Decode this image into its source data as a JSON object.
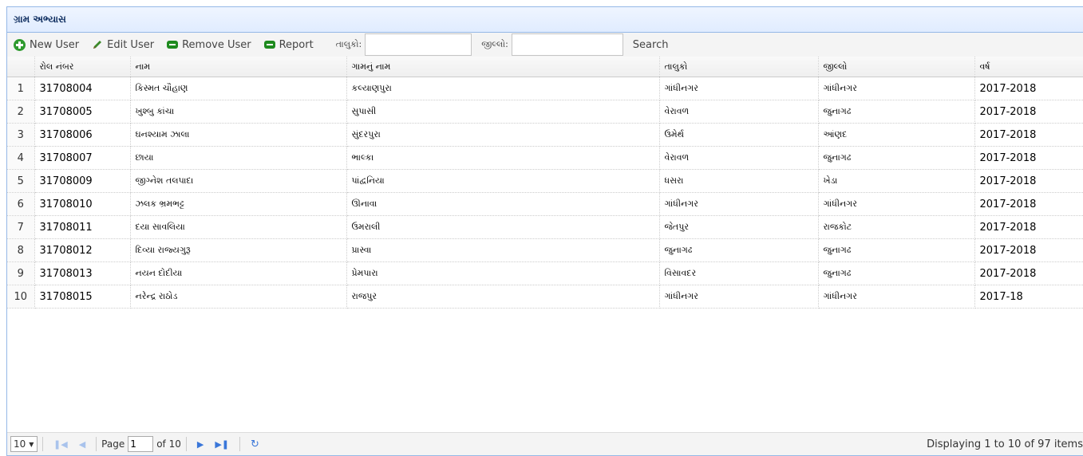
{
  "panel": {
    "title": "ગ્રામ અભ્યાસ"
  },
  "toolbar": {
    "new_user": "New User",
    "edit_user": "Edit User",
    "remove_user": "Remove User",
    "report": "Report",
    "taluka_label": "તાલુકો:",
    "district_label": "જીલ્લો:",
    "search": "Search"
  },
  "table": {
    "columns": [
      "રોલ નંબર",
      "નામ",
      "ગામનું નામ",
      "તાલુકો",
      "જીલ્લો",
      "વર્ષ"
    ],
    "rows": [
      {
        "n": "1",
        "roll": "31708004",
        "name": "કિસ્મત ચૌહાણ",
        "village": "કલ્યાણપુરા",
        "taluka": "ગાંધીનગર",
        "district": "ગાંધીનગર",
        "year": "2017-2018"
      },
      {
        "n": "2",
        "roll": "31708005",
        "name": "ખુશ્બુ કાંચા",
        "village": "સુપાસી",
        "taluka": "વેરાવળ",
        "district": "જુનાગઢ",
        "year": "2017-2018"
      },
      {
        "n": "3",
        "roll": "31708006",
        "name": "ઘનશ્યામ ઝાલા",
        "village": "સુંદરપુરા",
        "taluka": "ઉમેર્થ",
        "district": "આંણદ",
        "year": "2017-2018"
      },
      {
        "n": "4",
        "roll": "31708007",
        "name": "છાયા",
        "village": "ભાલ્કા",
        "taluka": "વેરાવળ",
        "district": "જુનાગઢ",
        "year": "2017-2018"
      },
      {
        "n": "5",
        "roll": "31708009",
        "name": "જીગ્નેશ તલપાદા",
        "village": "પાંદ્વનિયા",
        "taluka": "ધસરા",
        "district": "ખેડા",
        "year": "2017-2018"
      },
      {
        "n": "6",
        "roll": "31708010",
        "name": "ઝલક ભ્રમભટ્ટ",
        "village": "ઊનાવા",
        "taluka": "ગાંધીનગર",
        "district": "ગાંધીનગર",
        "year": "2017-2018"
      },
      {
        "n": "7",
        "roll": "31708011",
        "name": "દયા સાવલિયા",
        "village": "ઉમરાલી",
        "taluka": "જેતપુર",
        "district": "રાજકોટ",
        "year": "2017-2018"
      },
      {
        "n": "8",
        "roll": "31708012",
        "name": "દિવ્યા રાજ્યગુરૂ",
        "village": "પ્રાસ્વા",
        "taluka": "જુનાગઢ",
        "district": "જુનાગઢ",
        "year": "2017-2018"
      },
      {
        "n": "9",
        "roll": "31708013",
        "name": "નયન દોદીયા",
        "village": "પ્રેમપારા",
        "taluka": "વિસાવદર",
        "district": "જુનાગઢ",
        "year": "2017-2018"
      },
      {
        "n": "10",
        "roll": "31708015",
        "name": "નરેન્દ્ર રાઠોડ",
        "village": "રાજપુર",
        "taluka": "ગાંધીનગર",
        "district": "ગાંધીનગર",
        "year": "2017-18"
      }
    ]
  },
  "pager": {
    "page_size": "10",
    "page_label": "Page",
    "page_value": "1",
    "of_label": "of 10",
    "display": "Displaying 1 to 10 of 97 items"
  },
  "colors": {
    "header_border": "#95b8e7",
    "title_text": "#0e2d5f",
    "pager_icon": "#3a77d9"
  },
  "icons": [
    "add-icon",
    "edit-icon",
    "remove-icon",
    "report-icon",
    "first-page-icon",
    "prev-page-icon",
    "next-page-icon",
    "last-page-icon",
    "refresh-icon"
  ]
}
